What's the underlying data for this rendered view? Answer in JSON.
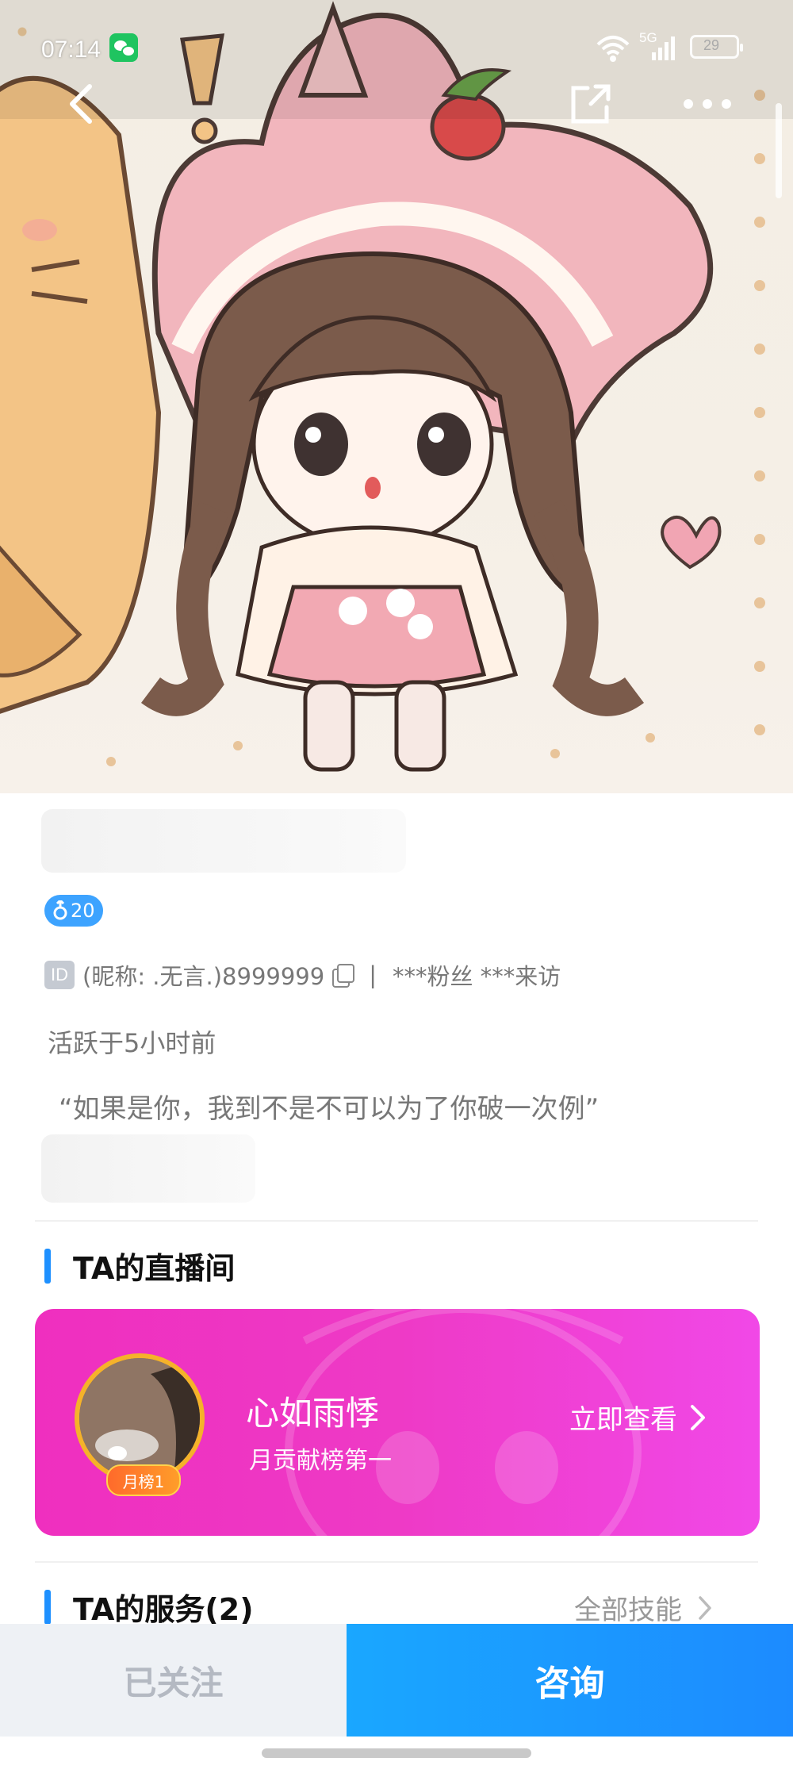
{
  "status_bar": {
    "time": "07:14",
    "network": "5G",
    "battery": "29",
    "icons": [
      "wechat-icon",
      "wifi-icon",
      "signal-icon",
      "battery-icon"
    ]
  },
  "nav": {
    "back_icon": "chevron-left-icon",
    "share_icon": "share-icon",
    "more_icon": "more-dots-icon"
  },
  "profile": {
    "age_badge": "20",
    "gender_icon": "male-icon",
    "id_tag": "ID",
    "nickname_id": "(昵称: .无言.)8999999",
    "stats": "***粉丝  ***来访",
    "separator": "|",
    "active": "活跃于5小时前",
    "motto": "“如果是你，我到不是不可以为了你破一次例”"
  },
  "live_section": {
    "title": "TA的直播间",
    "host_name": "心如雨悸",
    "host_sub": "月贡献榜第一",
    "rank_badge": "月榜1",
    "view_label": "立即查看",
    "colors": {
      "start": "#ef2fbf",
      "end": "#f148e7"
    }
  },
  "services_section": {
    "title": "TA的服务(2)",
    "all_skills": "全部技能"
  },
  "bottom": {
    "followed_label": "已关注",
    "consult_label": "咨询",
    "accent": "#1c8bff"
  }
}
